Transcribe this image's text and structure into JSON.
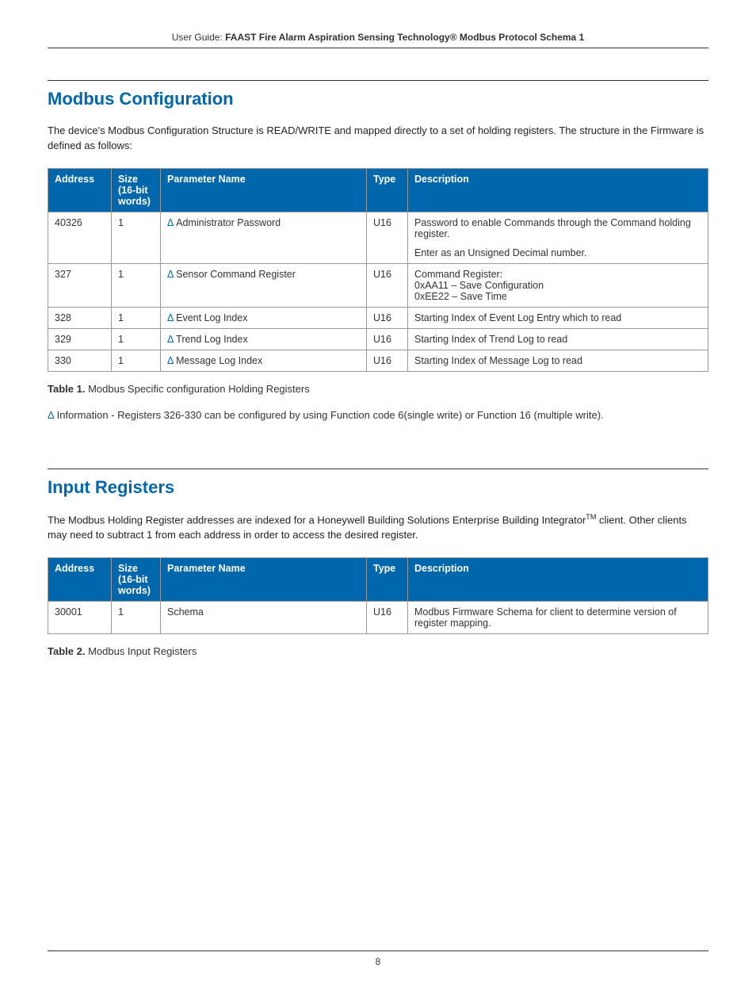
{
  "header": {
    "prefix": "User Guide: ",
    "title": "FAAST Fire Alarm Aspiration Sensing Technology® Modbus Protocol Schema 1"
  },
  "section1": {
    "heading": "Modbus Configuration",
    "intro": "The device's Modbus Configuration Structure is READ/WRITE and mapped directly to a set of holding registers. The structure in the Firmware is defined as follows:"
  },
  "table1": {
    "headers": {
      "address": "Address",
      "size": "Size (16-bit words)",
      "param": "Parameter Name",
      "type": "Type",
      "desc": "Description"
    },
    "rows": [
      {
        "address": "40326",
        "size": "1",
        "delta": "Δ",
        "param": " Administrator Password",
        "type": "U16",
        "desc": "Password to enable Commands through the Command holding register.\nEnter as an Unsigned Decimal number."
      },
      {
        "address": "327",
        "size": "1",
        "delta": "Δ",
        "param": " Sensor Command Register",
        "type": "U16",
        "desc": "Command Register:\n0xAA11 – Save Configuration\n0xEE22 – Save Time"
      },
      {
        "address": "328",
        "size": "1",
        "delta": "Δ",
        "param": " Event Log Index",
        "type": "U16",
        "desc": "Starting Index of Event Log Entry which to read"
      },
      {
        "address": "329",
        "size": "1",
        "delta": "Δ",
        "param": " Trend Log Index",
        "type": "U16",
        "desc": "Starting Index of Trend Log to read"
      },
      {
        "address": "330",
        "size": "1",
        "delta": "Δ",
        "param": " Message Log Index",
        "type": "U16",
        "desc": "Starting Index of Message Log to read"
      }
    ],
    "caption_label": "Table 1.",
    "caption_text": " Modbus Specific configuration Holding Registers",
    "note_delta": "Δ",
    "note_text": " Information - Registers 326-330 can be configured by using Function code 6(single write) or Function 16 (multiple write)."
  },
  "section2": {
    "heading": "Input Registers",
    "intro_pre": "The Modbus Holding Register addresses are indexed for a Honeywell Building Solutions Enterprise Building Integrator",
    "intro_tm": "TM",
    "intro_post": " client. Other clients may need to subtract 1 from each address in order to access the desired register."
  },
  "table2": {
    "headers": {
      "address": "Address",
      "size": "Size (16-bit words)",
      "param": "Parameter Name",
      "type": "Type",
      "desc": "Description"
    },
    "rows": [
      {
        "address": "30001",
        "size": "1",
        "param": "Schema",
        "type": "U16",
        "desc": "Modbus Firmware Schema for client to determine version of register mapping."
      }
    ],
    "caption_label": "Table 2.",
    "caption_text": " Modbus Input Registers"
  },
  "footer": {
    "page": "8"
  }
}
